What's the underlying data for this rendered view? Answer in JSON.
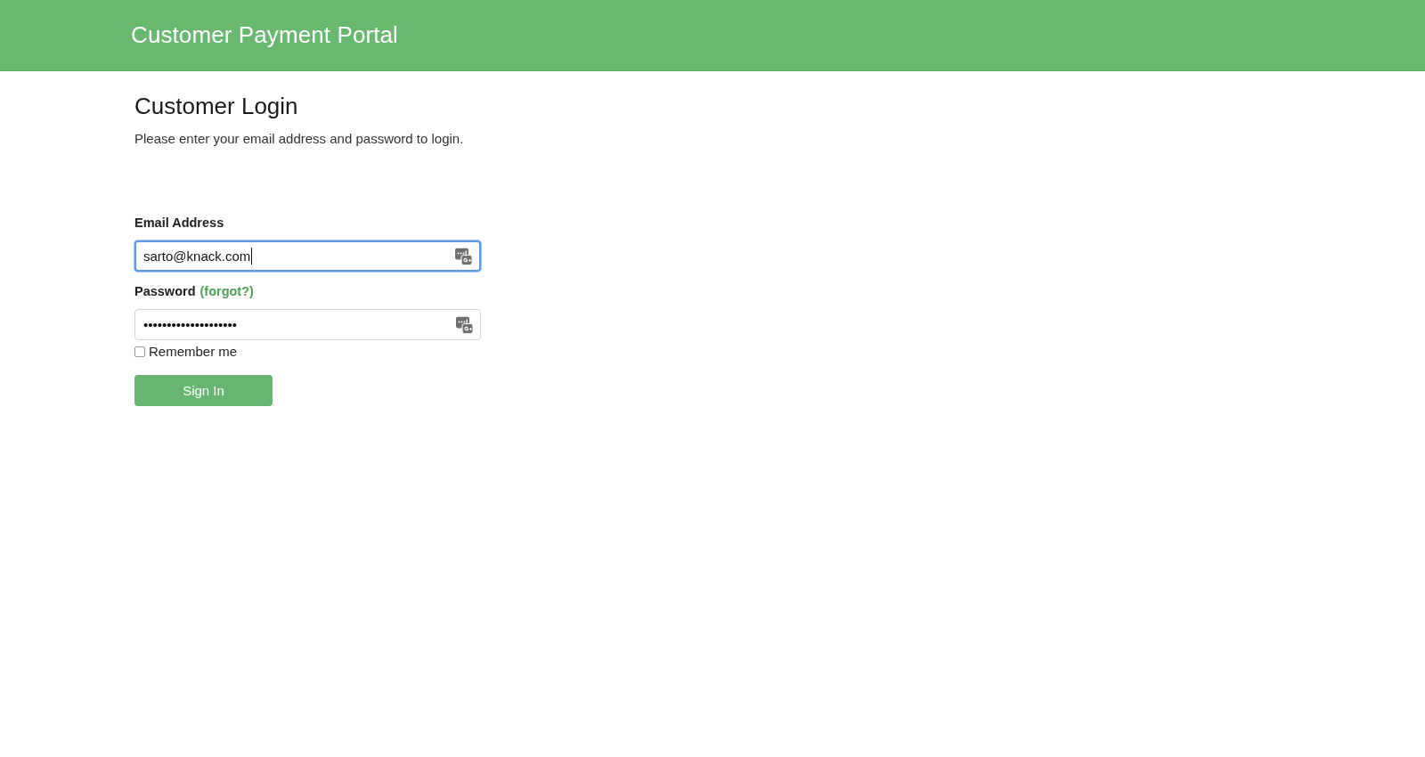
{
  "header": {
    "title": "Customer Payment Portal"
  },
  "login": {
    "heading": "Customer Login",
    "instructions": "Please enter your email address and password to login."
  },
  "fields": [
    {
      "label": "Email Address",
      "value": "sarto@knack.com",
      "focused": true
    },
    {
      "label": "Password",
      "link": "(forgot?)",
      "value": "••••••••••••••••••••",
      "focused": false
    }
  ],
  "remember": {
    "label": "Remember me",
    "checked": false
  },
  "button": {
    "label": "Sign In"
  }
}
